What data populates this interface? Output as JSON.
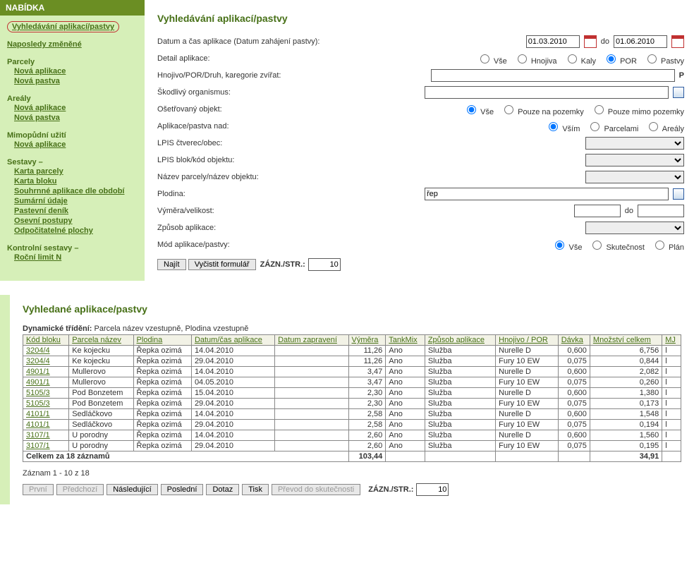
{
  "menuHeader": "NABÍDKA",
  "sidebar": {
    "search": "Vyhledávání aplikací/pastvy",
    "recent": "Naposledy změněné",
    "parcely": "Parcely",
    "novaAplikace": "Nová aplikace",
    "novaPastva": "Nová pastva",
    "arealy": "Areály",
    "mimopudni": "Mimopůdní užití",
    "sestavy": "Sestavy –",
    "kartaParcely": "Karta parcely",
    "kartaBloku": "Karta bloku",
    "souhrnne": "Souhrnné aplikace dle období",
    "sumarni": "Sumární údaje",
    "pastevni": "Pastevní deník",
    "osevni": "Osevní postupy",
    "odpoc": "Odpočitatelné plochy",
    "kontrolni": "Kontrolní sestavy –",
    "rocniLimit": "Roční limit N"
  },
  "form": {
    "title": "Vyhledávání aplikací/pastvy",
    "datumLabel": "Datum a čas aplikace (Datum zahájení pastvy):",
    "datumOd": "01.03.2010",
    "doWord": "do",
    "datumDo": "01.06.2010",
    "detailLabel": "Detail aplikace:",
    "detailOpts": [
      "Vše",
      "Hnojiva",
      "Kaly",
      "POR",
      "Pastvy"
    ],
    "hnojivoLabel": "Hnojivo/POR/Druh, karegorie zvířat:",
    "pBadge": "P",
    "skodLabel": "Škodlivý organismus:",
    "osetrLabel": "Ošetřovaný objekt:",
    "osetrOpts": [
      "Vše",
      "Pouze na pozemky",
      "Pouze mimo pozemky"
    ],
    "nadLabel": "Aplikace/pastva nad:",
    "nadOpts": [
      "Vším",
      "Parcelami",
      "Areály"
    ],
    "lpisCtverec": "LPIS čtverec/obec:",
    "lpisBlok": "LPIS blok/kód objektu:",
    "nazevParc": "Název parcely/název objektu:",
    "plodinaLabel": "Plodina:",
    "plodinaVal": "řep",
    "vymeraLabel": "Výměra/velikost:",
    "zpusobLabel": "Způsob aplikace:",
    "modLabel": "Mód aplikace/pastvy:",
    "modOpts": [
      "Vše",
      "Skutečnost",
      "Plán"
    ],
    "najit": "Najít",
    "vycistit": "Vyčistit formulář",
    "zaznStr": "ZÁZN./STR.:",
    "perPage": "10"
  },
  "results": {
    "title": "Vyhledané aplikace/pastvy",
    "sortLabel": "Dynamické třídění:",
    "sortDesc": "Parcela název vzestupně, Plodina vzestupně",
    "headers": [
      "Kód bloku",
      "Parcela název",
      "Plodina",
      "Datum/čas aplikace",
      "Datum zapravení",
      "Výměra",
      "TankMix",
      "Způsob aplikace",
      "Hnojivo / POR",
      "Dávka",
      "Množství celkem",
      "MJ"
    ],
    "rows": [
      [
        "3204/4",
        "Ke kojecku",
        "Řepka ozimá",
        "14.04.2010",
        "",
        "11,26",
        "Ano",
        "Služba",
        "Nurelle D",
        "0,600",
        "6,756",
        "l"
      ],
      [
        "3204/4",
        "Ke kojecku",
        "Řepka ozimá",
        "29.04.2010",
        "",
        "11,26",
        "Ano",
        "Služba",
        "Fury 10 EW",
        "0,075",
        "0,844",
        "l"
      ],
      [
        "4901/1",
        "Mullerovo",
        "Řepka ozimá",
        "14.04.2010",
        "",
        "3,47",
        "Ano",
        "Služba",
        "Nurelle D",
        "0,600",
        "2,082",
        "l"
      ],
      [
        "4901/1",
        "Mullerovo",
        "Řepka ozimá",
        "04.05.2010",
        "",
        "3,47",
        "Ano",
        "Služba",
        "Fury 10 EW",
        "0,075",
        "0,260",
        "l"
      ],
      [
        "5105/3",
        "Pod Bonzetem",
        "Řepka ozimá",
        "15.04.2010",
        "",
        "2,30",
        "Ano",
        "Služba",
        "Nurelle D",
        "0,600",
        "1,380",
        "l"
      ],
      [
        "5105/3",
        "Pod Bonzetem",
        "Řepka ozimá",
        "29.04.2010",
        "",
        "2,30",
        "Ano",
        "Služba",
        "Fury 10 EW",
        "0,075",
        "0,173",
        "l"
      ],
      [
        "4101/1",
        "Sedláčkovo",
        "Řepka ozimá",
        "14.04.2010",
        "",
        "2,58",
        "Ano",
        "Služba",
        "Nurelle D",
        "0,600",
        "1,548",
        "l"
      ],
      [
        "4101/1",
        "Sedláčkovo",
        "Řepka ozimá",
        "29.04.2010",
        "",
        "2,58",
        "Ano",
        "Služba",
        "Fury 10 EW",
        "0,075",
        "0,194",
        "l"
      ],
      [
        "3107/1",
        "U porodny",
        "Řepka ozimá",
        "14.04.2010",
        "",
        "2,60",
        "Ano",
        "Služba",
        "Nurelle D",
        "0,600",
        "1,560",
        "l"
      ],
      [
        "3107/1",
        "U porodny",
        "Řepka ozimá",
        "29.04.2010",
        "",
        "2,60",
        "Ano",
        "Služba",
        "Fury 10 EW",
        "0,075",
        "0,195",
        "l"
      ]
    ],
    "footerLabel": "Celkem za 18 záznamů",
    "footerVymera": "103,44",
    "footerMnozstvi": "34,91",
    "rangeText": "Záznam 1 - 10 z 18",
    "btnFirst": "První",
    "btnPrev": "Předchozí",
    "btnNext": "Následující",
    "btnLast": "Poslední",
    "btnDotaz": "Dotaz",
    "btnTisk": "Tisk",
    "btnPrevod": "Převod do skutečnosti"
  }
}
